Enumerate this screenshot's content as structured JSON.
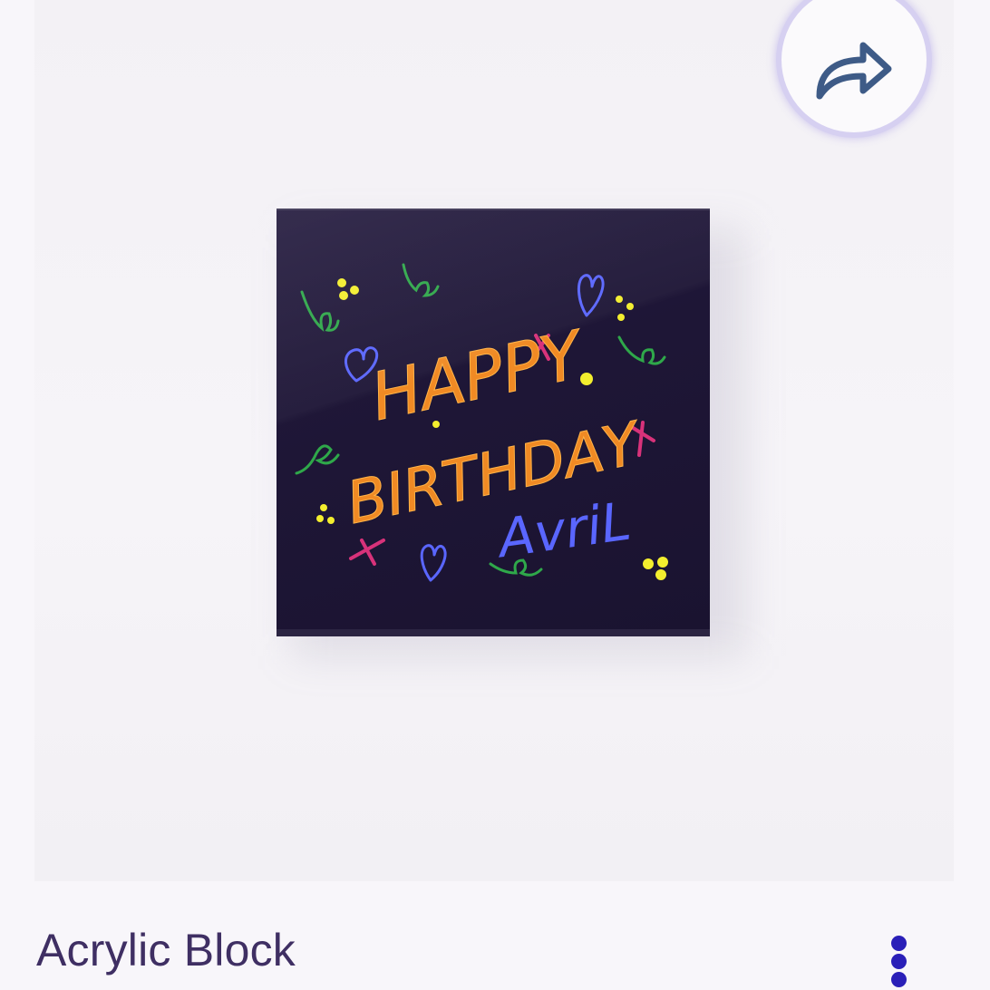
{
  "product": {
    "title": "Acrylic Block",
    "artwork": {
      "line1": "HAPPY",
      "line2": "BIRTHDAY",
      "line3": "AvriL"
    }
  },
  "icons": {
    "share": "share-arrow-icon",
    "more": "more-vertical-icon"
  },
  "colors": {
    "title": "#3f2f63",
    "accent": "#2a1fb8",
    "share_ring": "#d6d0f1",
    "block": "#1e1636",
    "lettering_orange": "#f08a24",
    "lettering_blue": "#5a66ff",
    "doodle_green": "#2fa84a"
  }
}
